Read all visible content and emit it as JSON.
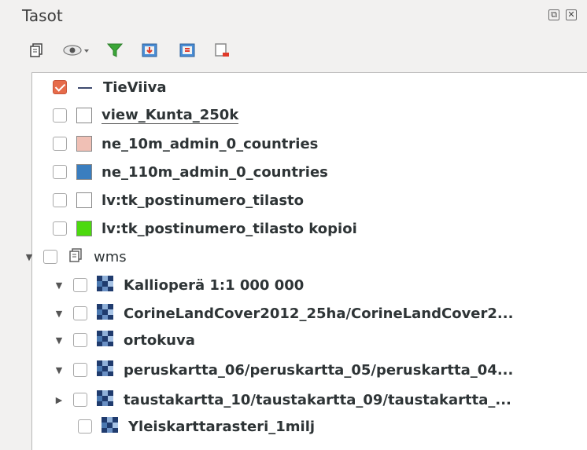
{
  "panel": {
    "title": "Tasot",
    "float_glyph": "⧉",
    "close_glyph": "✕"
  },
  "toolbar": {
    "icons": [
      "add-group-icon",
      "visibility-icon",
      "filter-icon",
      "expand-all-icon",
      "collapse-all-icon",
      "remove-layer-icon"
    ]
  },
  "layers": [
    {
      "label": "TieViiva",
      "checked": true,
      "symbol": "line",
      "bold": true
    },
    {
      "label": "view_Kunta_250k",
      "checked": false,
      "symbol": "fill",
      "color": "#ffffff",
      "bold": true
    },
    {
      "label": "ne_10m_admin_0_countries",
      "checked": false,
      "symbol": "fill",
      "color": "#f0c0b5",
      "bold": true
    },
    {
      "label": "ne_110m_admin_0_countries",
      "checked": false,
      "symbol": "fill",
      "color": "#3a7ebf",
      "bold": true
    },
    {
      "label": "lv:tk_postinumero_tilasto",
      "checked": false,
      "symbol": "fill",
      "color": "#ffffff",
      "bold": true
    },
    {
      "label": "lv:tk_postinumero_tilasto kopioi",
      "checked": false,
      "symbol": "fill",
      "color": "#4cd90e",
      "bold": true
    },
    {
      "label": "wms",
      "checked": false,
      "symbol": "group",
      "bold": false,
      "expanded": true
    },
    {
      "label": "Kallioperä 1:1 000 000",
      "checked": false,
      "symbol": "raster",
      "bold": true,
      "expanded": true
    },
    {
      "label": "CorineLandCover2012_25ha/CorineLandCover2...",
      "checked": false,
      "symbol": "raster",
      "bold": true,
      "expanded": true
    },
    {
      "label": "ortokuva",
      "checked": false,
      "symbol": "raster",
      "bold": true,
      "expanded": true
    },
    {
      "label": "peruskartta_06/peruskartta_05/peruskartta_04...",
      "checked": false,
      "symbol": "raster",
      "bold": true,
      "expanded": true
    },
    {
      "label": "taustakartta_10/taustakartta_09/taustakartta_...",
      "checked": false,
      "symbol": "raster",
      "bold": true,
      "expanded": false
    },
    {
      "label": "Yleiskarttarasteri_1milj",
      "checked": false,
      "symbol": "raster",
      "bold": true
    }
  ]
}
